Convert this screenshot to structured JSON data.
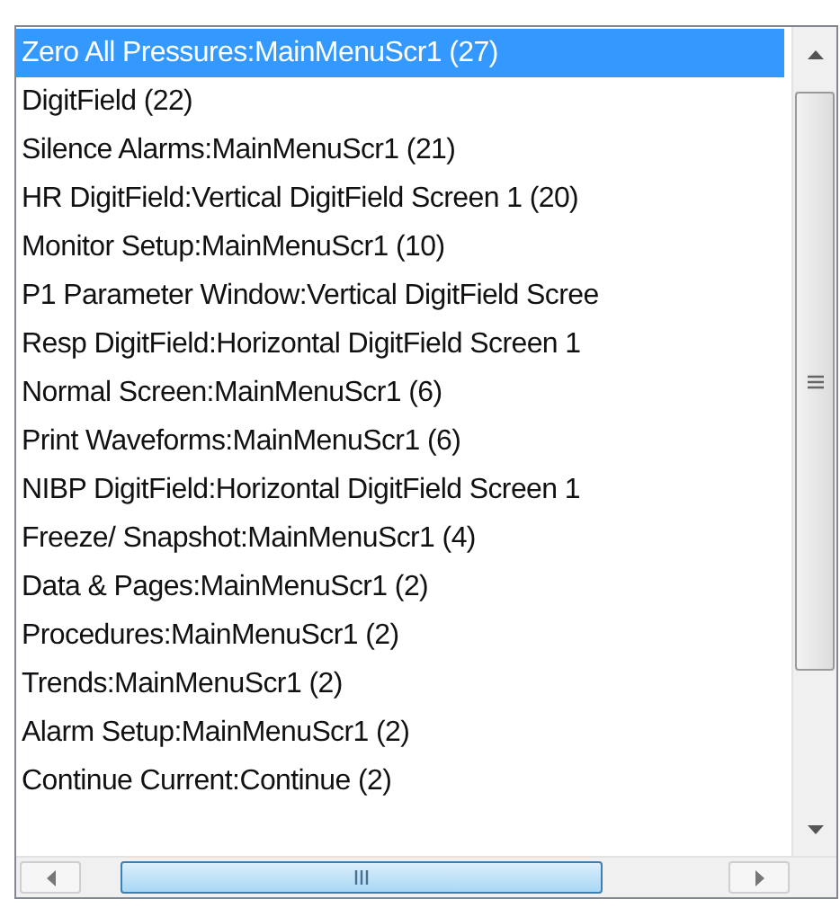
{
  "list": {
    "items": [
      {
        "label": "Zero All Pressures:MainMenuScr1  (27)",
        "selected": true
      },
      {
        "label": "DigitField  (22)",
        "selected": false
      },
      {
        "label": "Silence Alarms:MainMenuScr1  (21)",
        "selected": false
      },
      {
        "label": "HR DigitField:Vertical DigitField Screen 1  (20)",
        "selected": false
      },
      {
        "label": "Monitor Setup:MainMenuScr1  (10)",
        "selected": false
      },
      {
        "label": "P1 Parameter Window:Vertical DigitField Scree",
        "selected": false
      },
      {
        "label": "Resp DigitField:Horizontal DigitField Screen 1",
        "selected": false
      },
      {
        "label": "Normal Screen:MainMenuScr1  (6)",
        "selected": false
      },
      {
        "label": "Print Waveforms:MainMenuScr1  (6)",
        "selected": false
      },
      {
        "label": "NIBP DigitField:Horizontal DigitField Screen 1",
        "selected": false
      },
      {
        "label": "Freeze/ Snapshot:MainMenuScr1  (4)",
        "selected": false
      },
      {
        "label": "Data & Pages:MainMenuScr1  (2)",
        "selected": false
      },
      {
        "label": "Procedures:MainMenuScr1  (2)",
        "selected": false
      },
      {
        "label": "Trends:MainMenuScr1  (2)",
        "selected": false
      },
      {
        "label": "Alarm Setup:MainMenuScr1  (2)",
        "selected": false
      },
      {
        "label": "Continue Current:Continue  (2)",
        "selected": false
      }
    ]
  }
}
